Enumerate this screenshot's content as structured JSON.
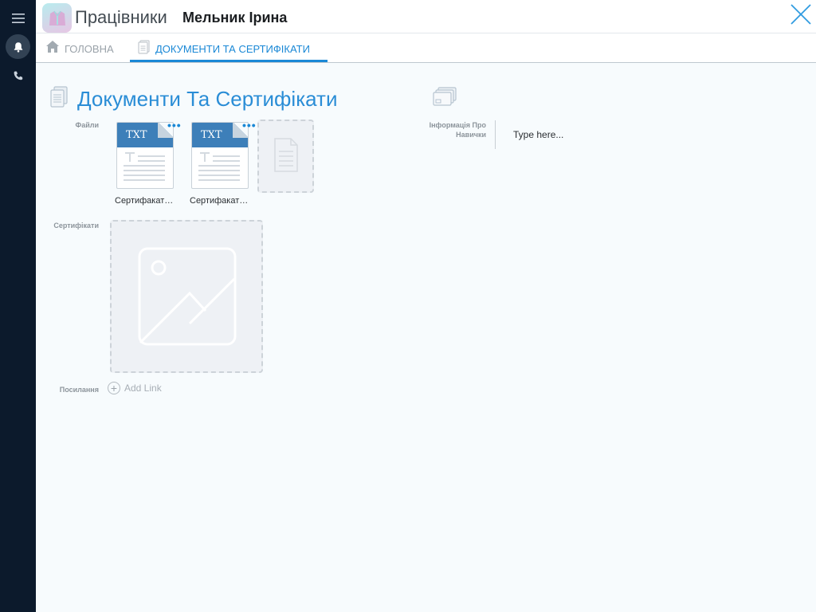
{
  "header": {
    "app_title": "Працівники",
    "record_title": "Мельник Ірина"
  },
  "tabs": [
    {
      "label": "ГОЛОВНА",
      "active": false
    },
    {
      "label": "ДОКУМЕНТИ ТА СЕРТИФІКАТИ",
      "active": true
    }
  ],
  "section": {
    "title": "Документи Та Сертифікати"
  },
  "fields": {
    "files_label": "Файли",
    "certificates_label": "Сертифікати",
    "links_label": "Посилання",
    "skills_label": "Інформація Про Навички",
    "skills_placeholder": "Type here..."
  },
  "files": [
    {
      "ext": "TXT",
      "name": "Сертифакат…"
    },
    {
      "ext": "TXT",
      "name": "Сертифакат…"
    }
  ],
  "add_link_label": "Add Link",
  "colors": {
    "accent": "#1a88d6",
    "rail": "#0c1a2c",
    "file_band": "#3d7fb9"
  }
}
